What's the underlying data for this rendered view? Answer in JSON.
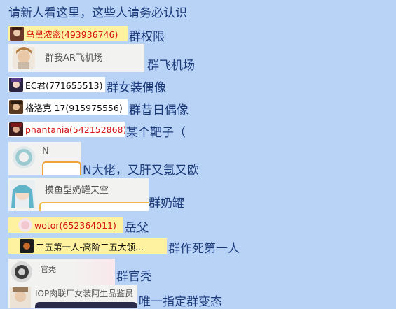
{
  "header": "请新人看这里，这些人请务必认识",
  "rows": [
    {
      "name": "乌黑浓密(493936746)",
      "label": "群权限"
    },
    {
      "name": "群我AR飞机场",
      "label": "群飞机场"
    },
    {
      "name": "EC君(771655513)",
      "label": "群女装偶像"
    },
    {
      "name": "格洛克 17(915975556)",
      "label": "群昔日偶像"
    },
    {
      "name": "phantania(542152868)",
      "label": "某个靶子（"
    },
    {
      "name": "N",
      "label": "N大佬，又肝又氪又欧"
    },
    {
      "name": "摸鱼型奶罐天空",
      "label": "群奶罐"
    },
    {
      "name": "wotor(652364011)",
      "label": "岳父"
    },
    {
      "name": "二五第一人-高阶二五大领...",
      "label": "群作死第一人"
    },
    {
      "name": "官秃",
      "label": "群官秃"
    },
    {
      "name": "IOP肉联厂女装阿生品鉴员",
      "label": "唯一指定群变态"
    }
  ],
  "colors": {
    "background": "#b9d3f6",
    "label_text": "#1b3a7a",
    "red_name": "#d21212",
    "yellow_chip": "#fef2a0",
    "orange_bubble": "#f0a437"
  },
  "icons": {
    "avatar": "avatar-icon"
  }
}
